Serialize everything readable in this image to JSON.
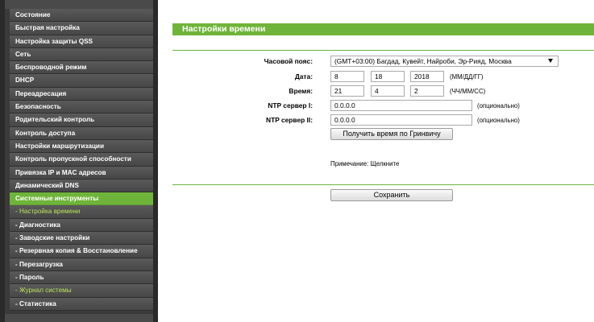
{
  "sidebar": {
    "items": [
      {
        "label": "Состояние",
        "type": "main"
      },
      {
        "label": "Быстрая настройка",
        "type": "main"
      },
      {
        "label": "Настройка защиты QSS",
        "type": "main"
      },
      {
        "label": "Сеть",
        "type": "main"
      },
      {
        "label": "Беспроводной режим",
        "type": "main"
      },
      {
        "label": "DHCP",
        "type": "main"
      },
      {
        "label": "Переадресация",
        "type": "main"
      },
      {
        "label": "Безопасность",
        "type": "main"
      },
      {
        "label": "Родительский контроль",
        "type": "main"
      },
      {
        "label": "Контроль доступа",
        "type": "main"
      },
      {
        "label": "Настройки маршрутизации",
        "type": "main"
      },
      {
        "label": "Контроль пропускной способности",
        "type": "main"
      },
      {
        "label": "Привязка IP и MAC адресов",
        "type": "main"
      },
      {
        "label": "Динамический DNS",
        "type": "main"
      },
      {
        "label": "Системные инструменты",
        "type": "active"
      },
      {
        "label": "- Настройка времени",
        "type": "sub-active"
      },
      {
        "label": "- Диагностика",
        "type": "sub"
      },
      {
        "label": "- Заводские настройки",
        "type": "sub"
      },
      {
        "label": "- Резервная копия & Восстановление",
        "type": "sub"
      },
      {
        "label": "- Перезагрузка",
        "type": "sub"
      },
      {
        "label": "- Пароль",
        "type": "sub"
      },
      {
        "label": "- Журнал системы",
        "type": "sub-green"
      },
      {
        "label": "- Статистика",
        "type": "sub"
      }
    ]
  },
  "page": {
    "title": "Настройки времени"
  },
  "form": {
    "timezone_label": "Часовой пояс:",
    "timezone_value": "(GMT+03:00) Багдад, Кувейт, Найроби, Эр-Рияд, Москва",
    "date_label": "Дата:",
    "date_month": "8",
    "date_day": "18",
    "date_year": "2018",
    "date_format": "(ММ/ДД/ГГ)",
    "time_label": "Время:",
    "time_hour": "21",
    "time_min": "4",
    "time_sec": "2",
    "time_format": "(ЧЧ/ММ/СС)",
    "ntp1_label": "NTP сервер I:",
    "ntp1_value": "0.0.0.0",
    "ntp2_label": "NTP сервер II:",
    "ntp2_value": "0.0.0.0",
    "optional": "(опционально)",
    "gmt_button": "Получить время по Гринвичу",
    "note": "Примечание: Щелкните",
    "save_button": "Сохранить"
  }
}
